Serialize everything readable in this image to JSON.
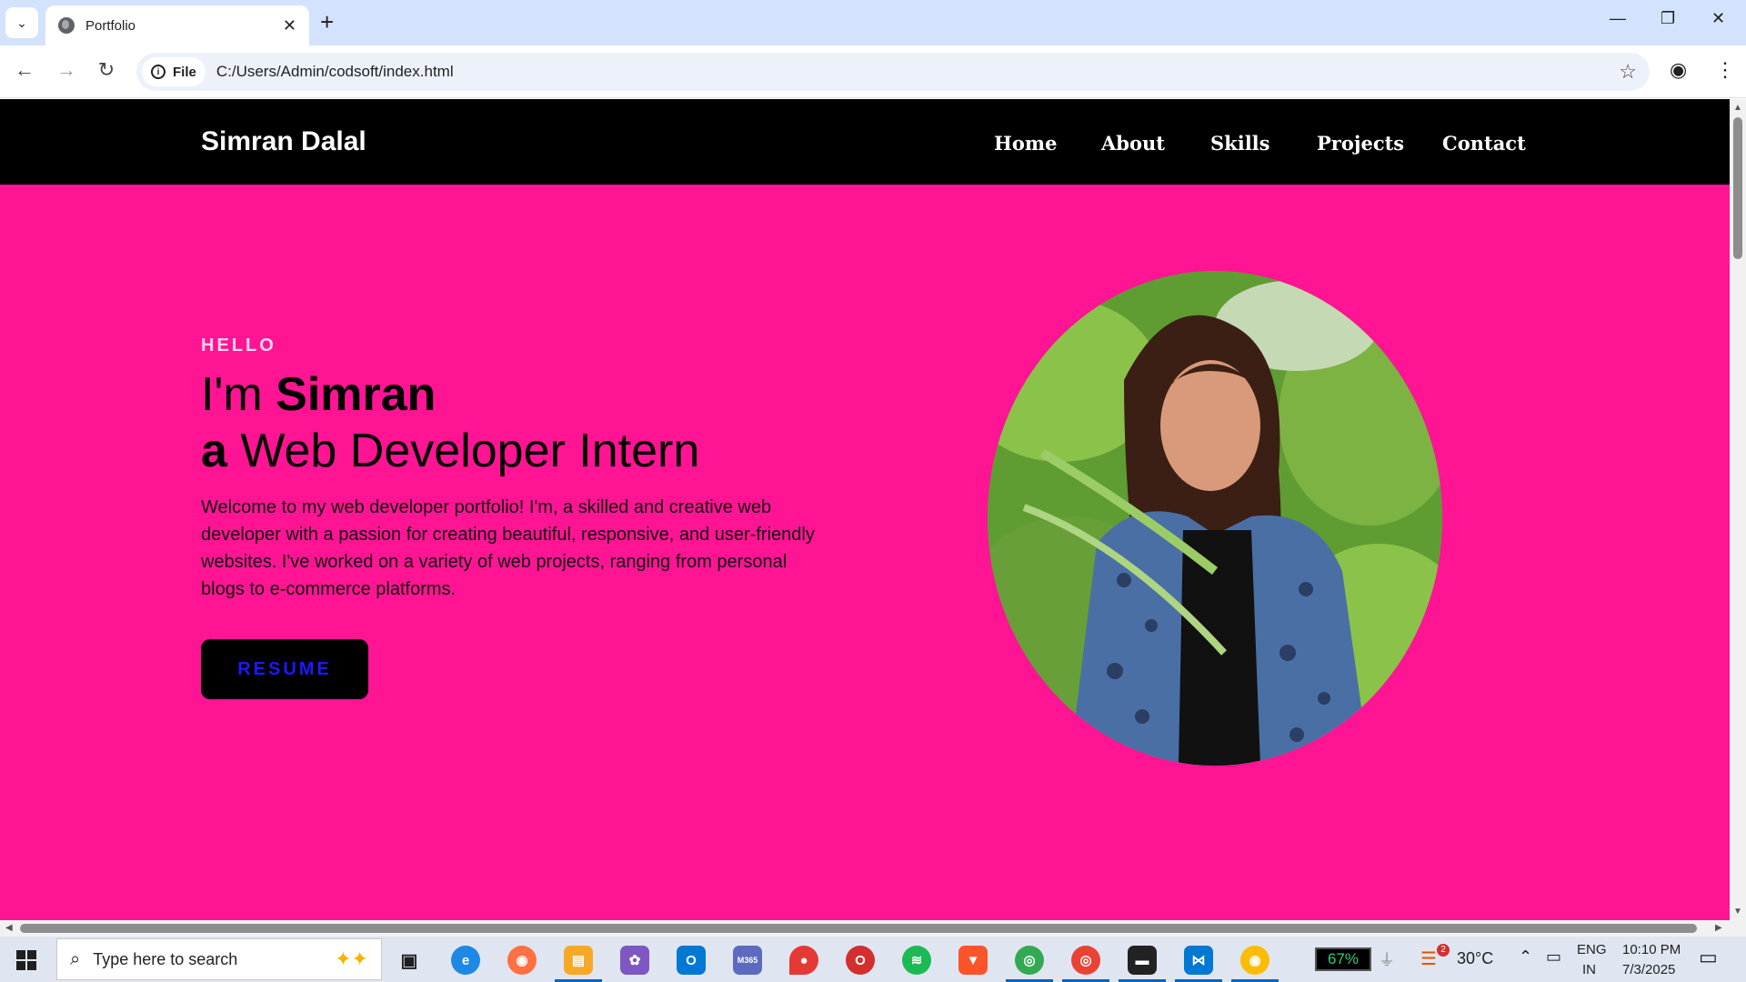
{
  "browser": {
    "tab_title": "Portfolio",
    "new_tab": "+",
    "url_chip": "File",
    "url": "C:/Users/Admin/codsoft/index.html"
  },
  "site": {
    "logo": "Simran Dalal",
    "nav": [
      "Home",
      "About",
      "Skills",
      "Projects",
      "Contact"
    ],
    "hero": {
      "eyebrow": "HELLO",
      "line1_pre": "I'm ",
      "line1_name": "Simran",
      "line2_pre": "a",
      "line2_rest": " Web Developer Intern",
      "intro": "Welcome to my web developer portfolio! I'm, a skilled and creative web developer with a passion for creating beautiful, responsive, and user-friendly websites. I've worked on a variety of web projects, ranging from personal blogs to e-commerce platforms.",
      "button": "RESUME"
    },
    "colors": {
      "hero_bg": "#ff1493",
      "nav_bg": "#000000",
      "button_text": "#1a1aff"
    }
  },
  "taskbar": {
    "search_placeholder": "Type here to search",
    "battery": "67%",
    "weather_badge": "2",
    "temperature": "30°C",
    "lang_top": "ENG",
    "lang_bottom": "IN",
    "time": "10:10 PM",
    "date": "7/3/2025"
  }
}
